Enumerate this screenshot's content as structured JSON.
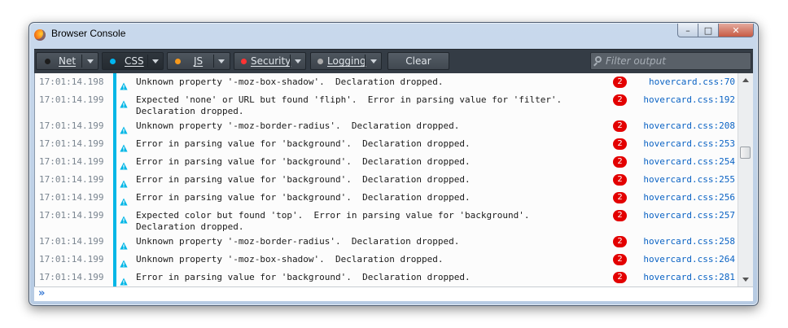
{
  "window": {
    "title": "Browser Console",
    "controls": {
      "minimize": "–",
      "maximize": "□",
      "close": "✕"
    }
  },
  "toolbar": {
    "filters": [
      {
        "id": "net",
        "label": "Net",
        "dot_color": "#1d1d1d",
        "checked": false
      },
      {
        "id": "css",
        "label": "CSS",
        "dot_color": "#00b6f0",
        "checked": true
      },
      {
        "id": "js",
        "label": "JS",
        "dot_color": "#f89a1c",
        "checked": false
      },
      {
        "id": "security",
        "label": "Security",
        "dot_color": "#ff3333",
        "checked": false
      },
      {
        "id": "logging",
        "label": "Logging",
        "dot_color": "#aaaaaa",
        "checked": false
      }
    ],
    "clear_label": "Clear",
    "filter_placeholder": "Filter output"
  },
  "colors": {
    "css_category": "#00b6e6",
    "warning_icon": "#00b6e6",
    "badge": "#e30000",
    "link": "#0b63c4"
  },
  "messages": [
    {
      "timestamp": "17:01:14.198",
      "text": "Unknown property '-moz-box-shadow'.  Declaration dropped.",
      "count": "2",
      "location": "hovercard.css:70"
    },
    {
      "timestamp": "17:01:14.199",
      "text": "Expected 'none' or URL but found 'fliph'.  Error in parsing value for 'filter'.\nDeclaration dropped.",
      "count": "2",
      "location": "hovercard.css:192"
    },
    {
      "timestamp": "17:01:14.199",
      "text": "Unknown property '-moz-border-radius'.  Declaration dropped.",
      "count": "2",
      "location": "hovercard.css:208"
    },
    {
      "timestamp": "17:01:14.199",
      "text": "Error in parsing value for 'background'.  Declaration dropped.",
      "count": "2",
      "location": "hovercard.css:253"
    },
    {
      "timestamp": "17:01:14.199",
      "text": "Error in parsing value for 'background'.  Declaration dropped.",
      "count": "2",
      "location": "hovercard.css:254"
    },
    {
      "timestamp": "17:01:14.199",
      "text": "Error in parsing value for 'background'.  Declaration dropped.",
      "count": "2",
      "location": "hovercard.css:255"
    },
    {
      "timestamp": "17:01:14.199",
      "text": "Error in parsing value for 'background'.  Declaration dropped.",
      "count": "2",
      "location": "hovercard.css:256"
    },
    {
      "timestamp": "17:01:14.199",
      "text": "Expected color but found 'top'.  Error in parsing value for 'background'.\nDeclaration dropped.",
      "count": "2",
      "location": "hovercard.css:257"
    },
    {
      "timestamp": "17:01:14.199",
      "text": "Unknown property '-moz-border-radius'.  Declaration dropped.",
      "count": "2",
      "location": "hovercard.css:258"
    },
    {
      "timestamp": "17:01:14.199",
      "text": "Unknown property '-moz-box-shadow'.  Declaration dropped.",
      "count": "2",
      "location": "hovercard.css:264"
    },
    {
      "timestamp": "17:01:14.199",
      "text": "Error in parsing value for 'background'.  Declaration dropped.",
      "count": "2",
      "location": "hovercard.css:281"
    }
  ],
  "input": {
    "prompt_icon": "»",
    "value": ""
  }
}
